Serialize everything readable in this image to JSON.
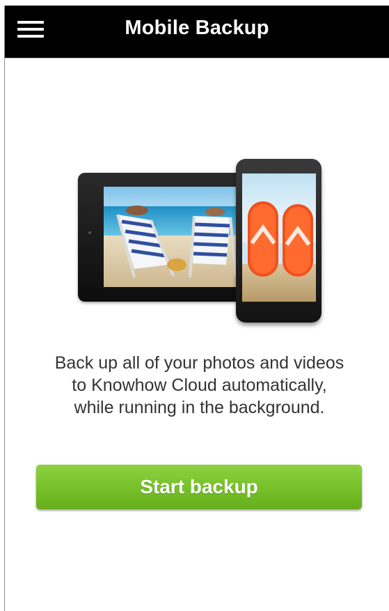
{
  "header": {
    "title": "Mobile Backup",
    "menu_icon": "hamburger-menu-icon",
    "background": "#000000"
  },
  "illustration": {
    "tablet_photo": "beach-chairs-photo",
    "phone_photo": "flip-flops-photo"
  },
  "main": {
    "message_lines": [
      "Back up all of your photos and videos",
      "to Knowhow Cloud automatically,",
      "while running in the background."
    ],
    "start_button_label": "Start backup"
  },
  "colors": {
    "accent": "#76c02a",
    "text": "#333333"
  }
}
